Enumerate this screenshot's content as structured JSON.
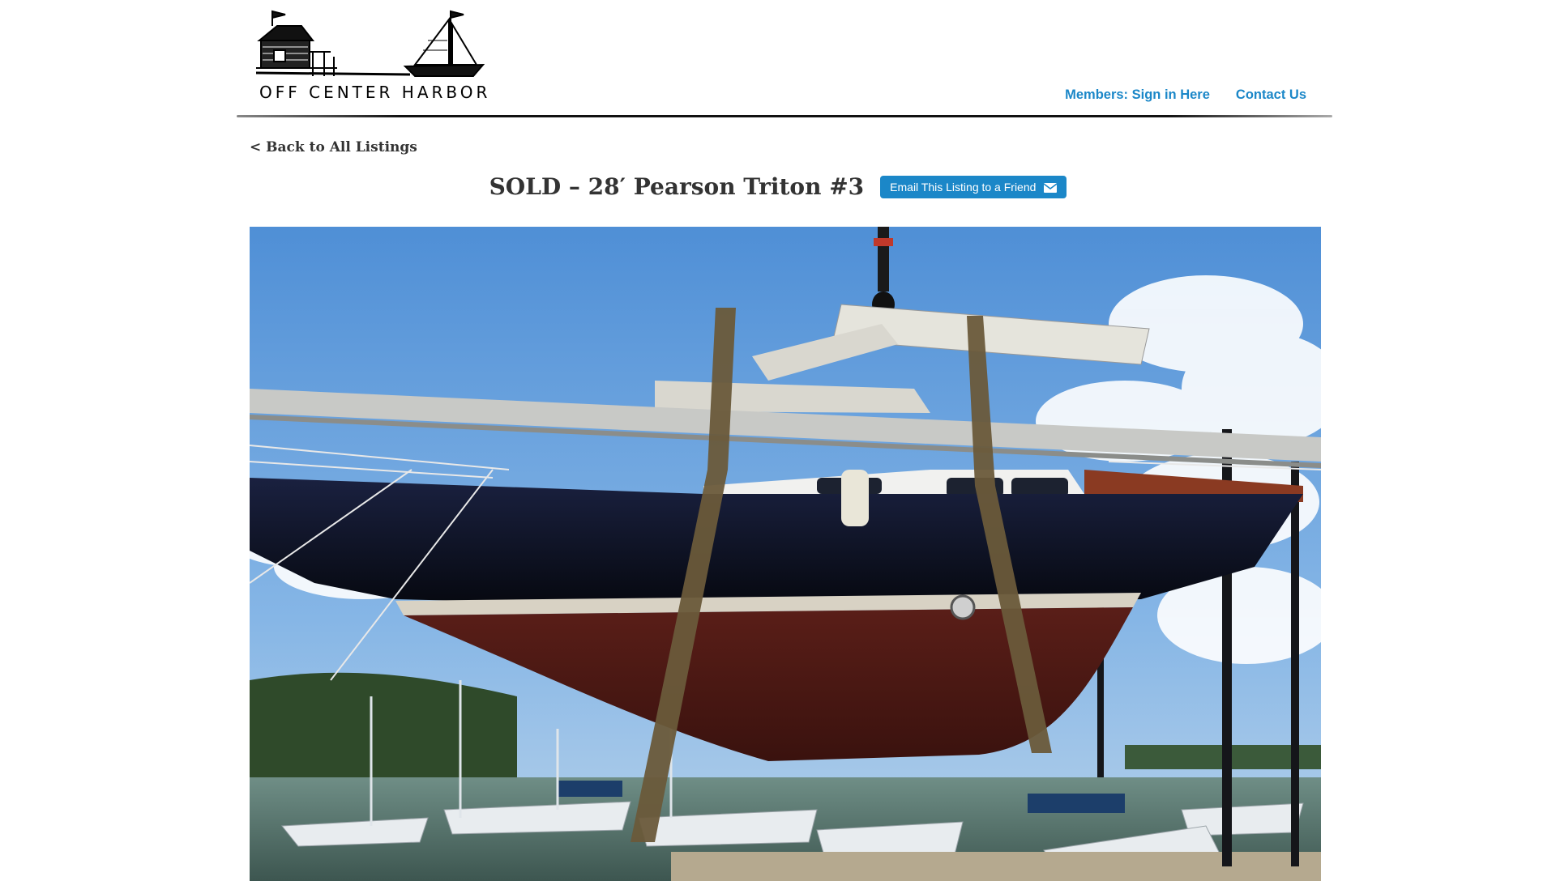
{
  "header": {
    "logo_text": "OFF CENTER HARBOR",
    "nav": {
      "members_label": "Members: Sign in Here",
      "contact_label": "Contact Us"
    }
  },
  "listing": {
    "back_label": "< Back to All Listings",
    "title": "SOLD – 28′ Pearson Triton #3",
    "email_button_label": "Email This Listing to a Friend",
    "email_icon": "envelope-icon"
  },
  "colors": {
    "link": "#1b87c8",
    "button_bg": "#1b87c8",
    "title_text": "#333333"
  }
}
